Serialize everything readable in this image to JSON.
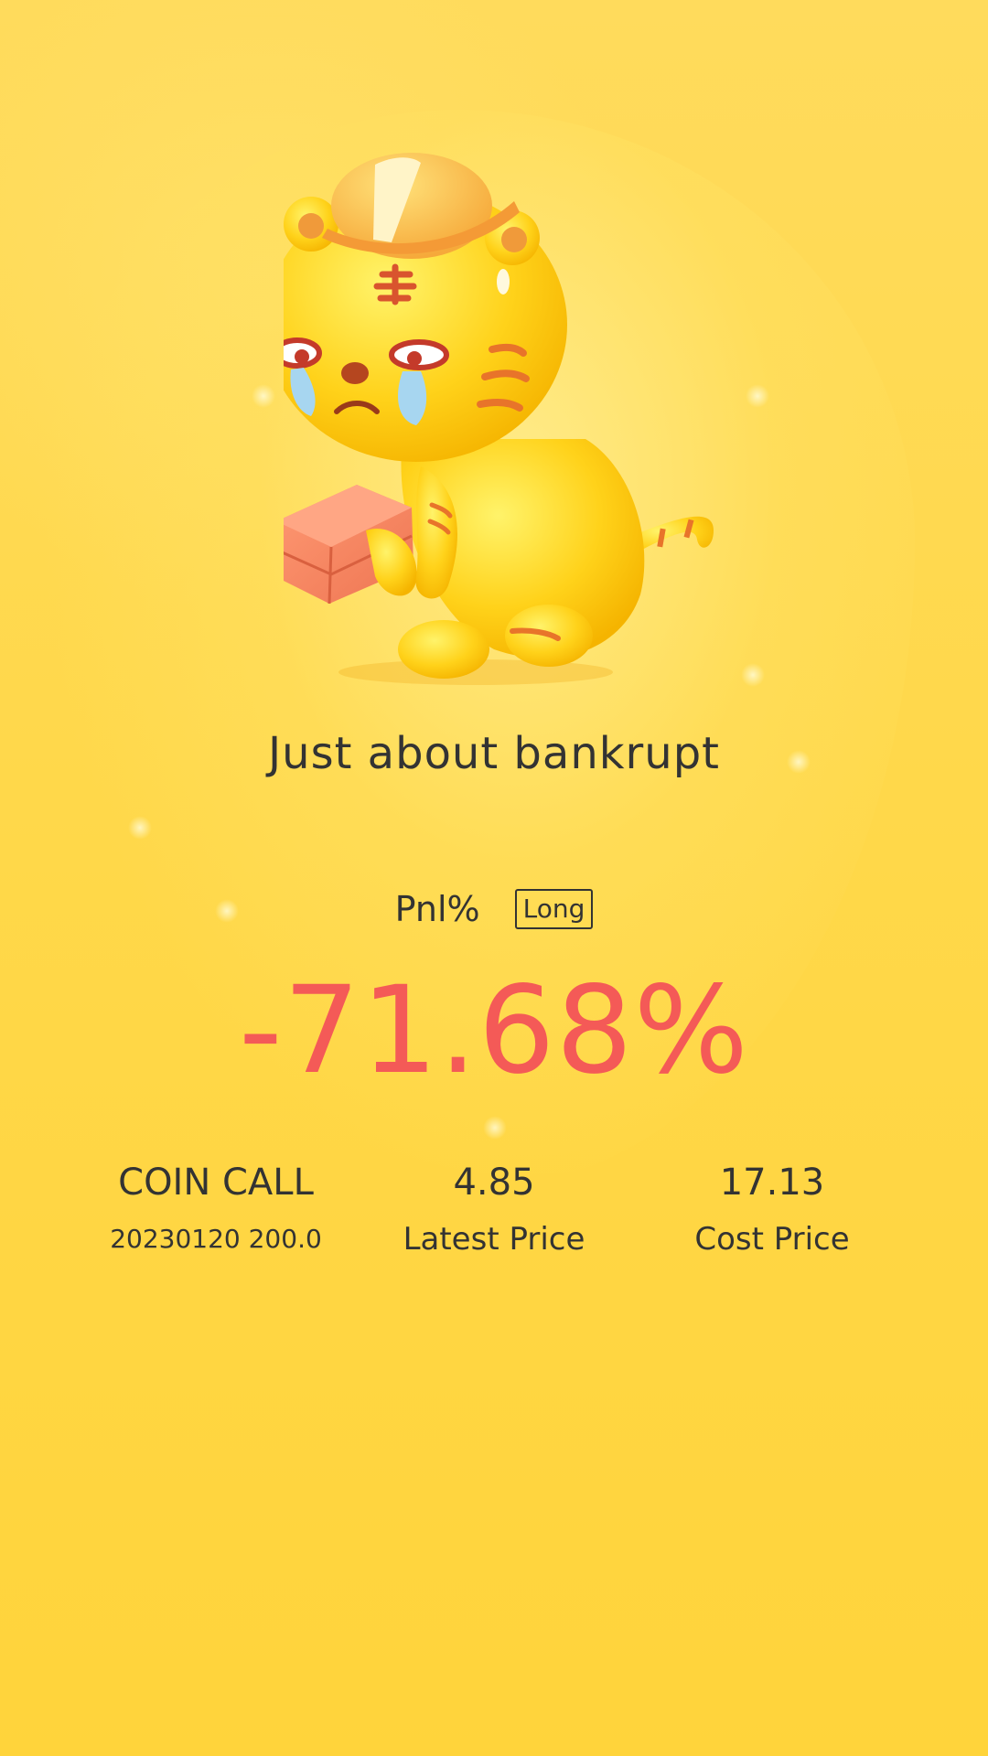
{
  "result": {
    "headline": "Just about bankrupt"
  },
  "pnl": {
    "label": "Pnl%",
    "direction": "Long",
    "value": "-71.68%"
  },
  "stats": {
    "instrument_name": "COIN CALL",
    "instrument_detail": "20230120 200.0",
    "latest_price_value": "4.85",
    "latest_price_label": "Latest Price",
    "cost_price_value": "17.13",
    "cost_price_label": "Cost Price"
  },
  "colors": {
    "background": "#ffd84a",
    "loss": "#f45a57",
    "text": "#333333"
  },
  "illustration": {
    "icon": "crying-tiger-mascot-icon"
  }
}
